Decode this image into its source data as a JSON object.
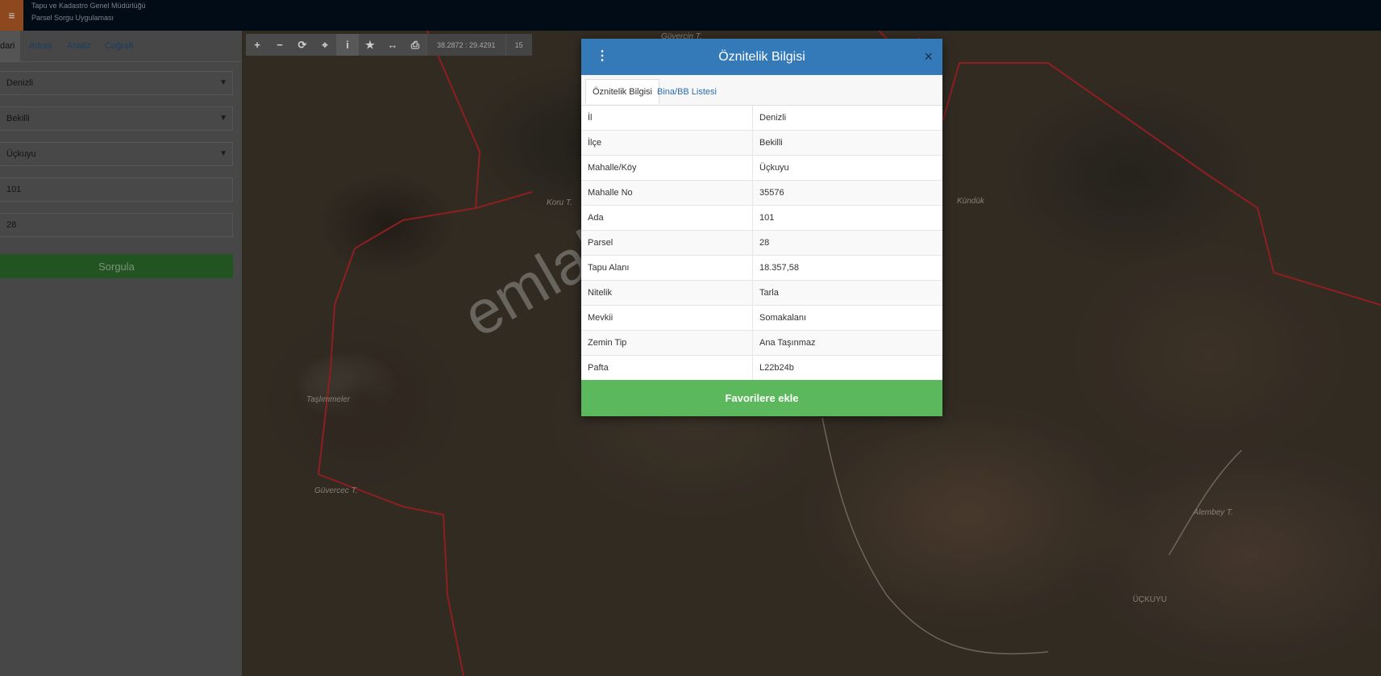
{
  "header": {
    "org": "Tapu ve Kadastro Genel Müdürlüğü",
    "app": "Parsel Sorgu Uygulaması",
    "menu_icon": "hamburger-icon"
  },
  "panel": {
    "tabs": [
      "dari",
      "Adres",
      "Analiz",
      "Coğrafi"
    ],
    "fields": [
      "Denizli",
      "Bekilli",
      "Üçkuyu",
      "101",
      "28"
    ],
    "query_button": "Sorgula"
  },
  "toolbar": {
    "icons": [
      "plus-icon",
      "minus-icon",
      "refresh-icon",
      "locate-icon",
      "info-icon",
      "star-icon",
      "measure-icon",
      "print-icon"
    ],
    "coordinates": "38.2872 : 29.4291",
    "zoom": "15"
  },
  "map": {
    "labels": [
      "Koru T.",
      "Güvercin T.",
      "Kündük",
      "Taşlımmeler",
      "Güvercec T.",
      "Alembey T.",
      "ÜÇKUYU"
    ]
  },
  "modal": {
    "title": "Öznitelik Bilgisi",
    "tabs": [
      "Öznitelik Bilgisi",
      "Bina/BB Listesi"
    ],
    "rows": [
      {
        "key": "İl",
        "value": "Denizli"
      },
      {
        "key": "İlçe",
        "value": "Bekilli"
      },
      {
        "key": "Mahalle/Köy",
        "value": "Üçkuyu"
      },
      {
        "key": "Mahalle No",
        "value": "35576"
      },
      {
        "key": "Ada",
        "value": "101"
      },
      {
        "key": "Parsel",
        "value": "28"
      },
      {
        "key": "Tapu Alanı",
        "value": "18.357,58"
      },
      {
        "key": "Nitelik",
        "value": "Tarla"
      },
      {
        "key": "Mevkii",
        "value": "Somakalanı"
      },
      {
        "key": "Zemin Tip",
        "value": "Ana Taşınmaz"
      },
      {
        "key": "Pafta",
        "value": "L22b24b"
      }
    ],
    "favorite_button": "Favorilere ekle"
  },
  "watermark": "emlakjet.com"
}
